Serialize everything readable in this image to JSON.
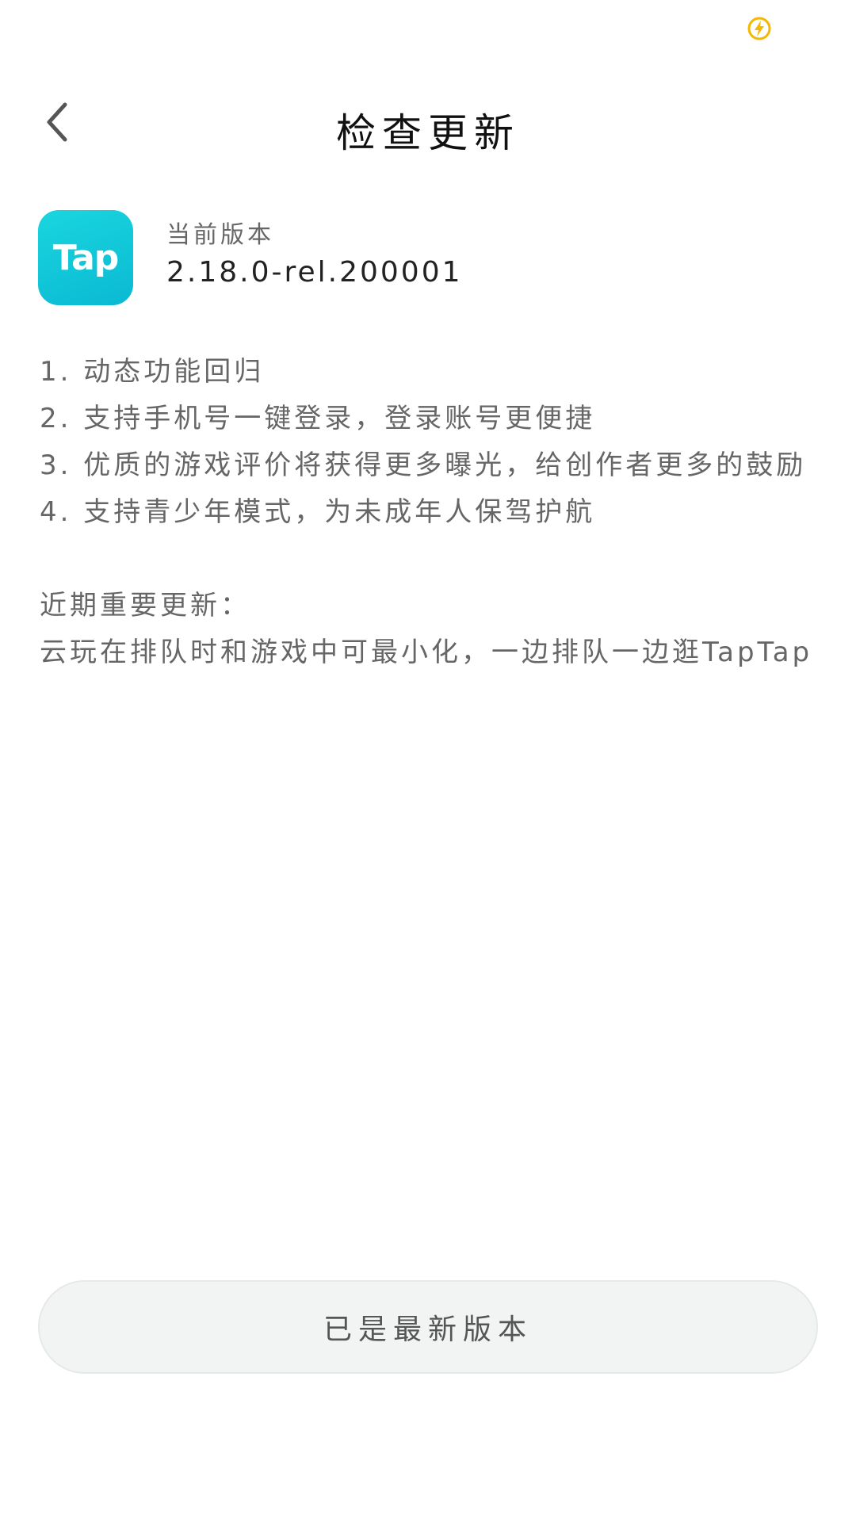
{
  "header": {
    "title": "检查更新"
  },
  "app": {
    "logo_text": "Tap",
    "version_caption": "当前版本",
    "version": "2.18.0-rel.200001"
  },
  "release_notes": {
    "items": [
      "1. 动态功能回归",
      "2. 支持手机号一键登录，登录账号更便捷",
      "3. 优质的游戏评价将获得更多曝光，给创作者更多的鼓励",
      "4. 支持青少年模式，为未成年人保驾护航"
    ],
    "recent_heading": "近期重要更新：",
    "recent_text": "云玩在排队时和游戏中可最小化，一边排队一边逛TapTap"
  },
  "footer": {
    "status_label": "已是最新版本"
  },
  "icons": {
    "back": "chevron-left-icon",
    "charging": "charging-icon"
  },
  "colors": {
    "brand": "#14c9d8",
    "text_primary": "#111111",
    "text_secondary": "#666666",
    "button_bg": "#f2f4f4",
    "charging_accent": "#f5b800"
  }
}
